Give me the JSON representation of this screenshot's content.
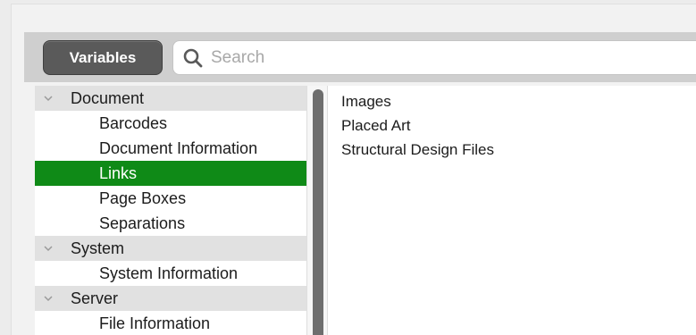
{
  "toolbar": {
    "variables_label": "Variables",
    "search_placeholder": "Search"
  },
  "tree": {
    "groups": [
      {
        "label": "Document",
        "children": [
          "Barcodes",
          "Document Information",
          "Links",
          "Page Boxes",
          "Separations"
        ]
      },
      {
        "label": "System",
        "children": [
          "System Information"
        ]
      },
      {
        "label": "Server",
        "children": [
          "File Information"
        ]
      }
    ],
    "selected": "Links"
  },
  "details": {
    "items": [
      "Images",
      "Placed Art",
      "Structural Design Files"
    ]
  },
  "colors": {
    "selection": "#0f8a17",
    "button": "#5a5a5a"
  }
}
